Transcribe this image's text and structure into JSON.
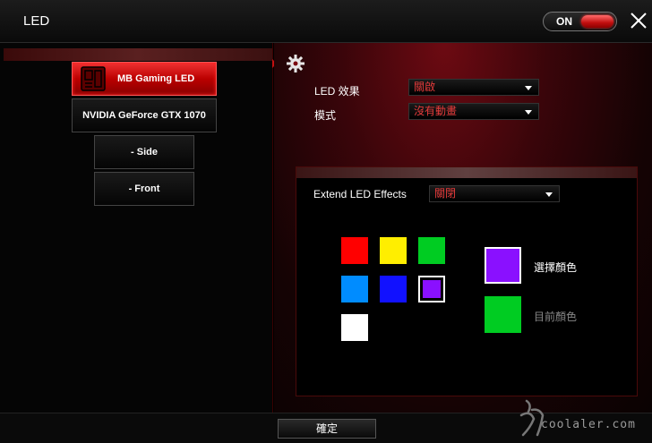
{
  "window": {
    "title": "LED"
  },
  "power_toggle": {
    "label": "ON",
    "state": "on"
  },
  "nav": {
    "items": [
      {
        "label": "MB Gaming LED",
        "active": true
      },
      {
        "label": "NVIDIA GeForce GTX 1070",
        "active": false
      },
      {
        "label": "- Side",
        "active": false
      },
      {
        "label": "- Front",
        "active": false
      }
    ]
  },
  "settings": {
    "led_effect": {
      "label": "LED 效果",
      "value": "關啟"
    },
    "mode": {
      "label": "模式",
      "value": "沒有動畫"
    }
  },
  "extend": {
    "label": "Extend LED Effects",
    "value": "關閉"
  },
  "palette": {
    "colors": [
      "#ff0000",
      "#ffee00",
      "#00cc22",
      "#008cff",
      "#1111ff",
      "#8a10ff",
      "#ffffff"
    ],
    "selected_index": 5
  },
  "color_select": {
    "selected_label": "選擇顏色",
    "selected_color": "#8a10ff",
    "current_label": "目前顏色",
    "current_color": "#00cc22"
  },
  "footer": {
    "ok_label": "確定"
  },
  "watermark": {
    "text": "coolaler.com"
  },
  "colors": {
    "accent": "#c41010",
    "dropdown_text": "#e43b3b"
  }
}
